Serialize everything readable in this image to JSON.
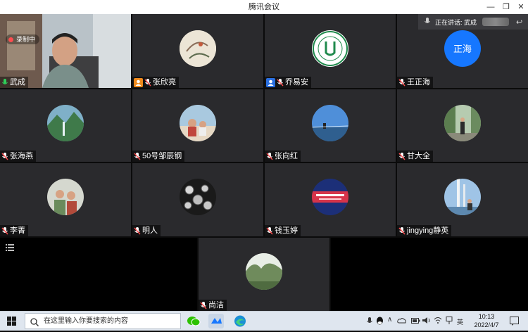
{
  "window": {
    "title": "腾讯会议"
  },
  "speaking": {
    "label": "正在讲话: 武成"
  },
  "recording": {
    "label": "录制中"
  },
  "participants": [
    {
      "name": "武成"
    },
    {
      "name": "张欣亮"
    },
    {
      "name": "乔易安"
    },
    {
      "name": "王正海",
      "avatar_text": "正海"
    },
    {
      "name": "张海燕"
    },
    {
      "name": "50号邹辰钢"
    },
    {
      "name": "张向红"
    },
    {
      "name": "甘大全"
    },
    {
      "name": "李菁"
    },
    {
      "name": "明人"
    },
    {
      "name": "钱玉婷"
    },
    {
      "name": "jingying静英"
    },
    {
      "name": "尚洁"
    }
  ],
  "taskbar": {
    "search_placeholder": "在这里输入你要搜索的内容",
    "time": "10:13",
    "date": "2022/4/7",
    "lang": "英"
  },
  "colors": {
    "accent_blue": "#1677ff",
    "tile_bg": "#2a2a2d",
    "badge_orange": "#f08a1c"
  }
}
